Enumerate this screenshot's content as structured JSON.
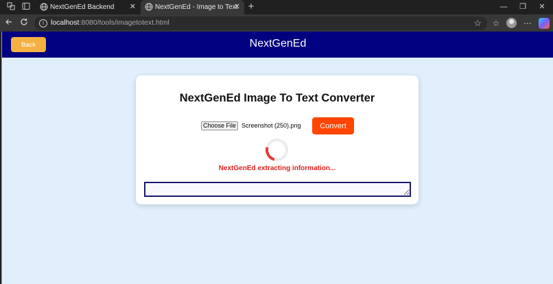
{
  "browser": {
    "tabs": [
      {
        "title": "NextGenEd Backend",
        "active": false
      },
      {
        "title": "NextGenEd - Image to Text",
        "active": true
      }
    ],
    "close_glyph": "✕",
    "new_tab_glyph": "+",
    "window_controls": {
      "minimize": "—",
      "restore": "❐",
      "close": "✕"
    },
    "url_host": "localhost",
    "url_rest": ":8080/tools/imagetotext.html"
  },
  "header": {
    "back_label": "Back",
    "brand": "NextGenEd"
  },
  "converter": {
    "title": "NextGenEd Image To Text Converter",
    "choose_file_label": "Choose File",
    "file_name": "Screenshot (250).png",
    "convert_label": "Convert",
    "status": "NextGenEd extracting information...",
    "output_value": ""
  },
  "colors": {
    "header_bg": "#000080",
    "back_button": "#f5b042",
    "convert_button": "#ff4500",
    "status_text": "#e02020",
    "page_bg": "#e1effd"
  }
}
